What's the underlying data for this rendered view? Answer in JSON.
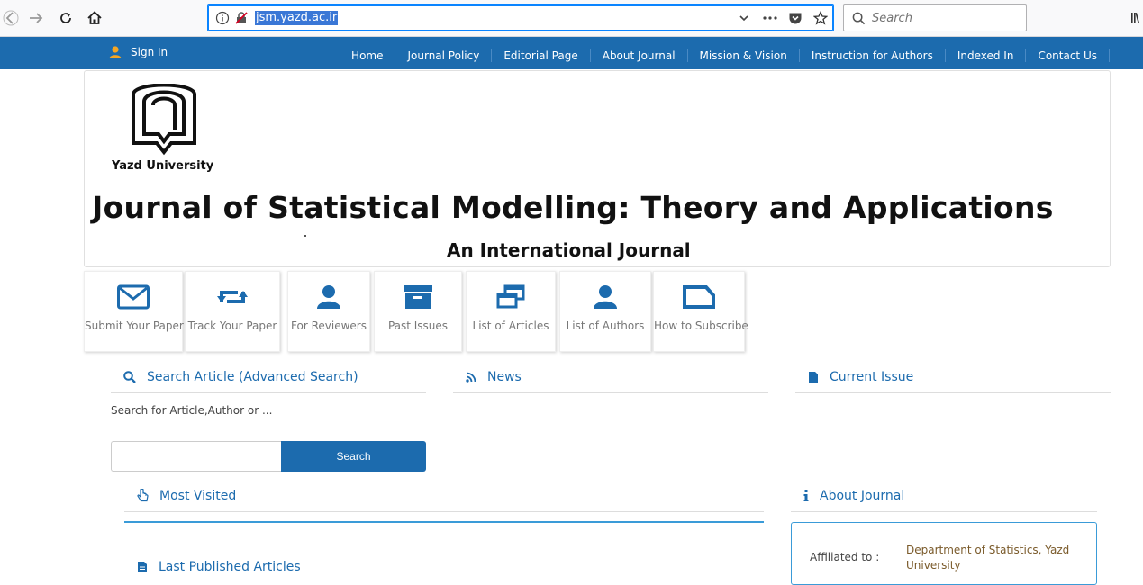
{
  "browser": {
    "url": "jsm.yazd.ac.ir",
    "search_placeholder": "Search"
  },
  "topnav": {
    "signin_label": "Sign In",
    "menu": [
      {
        "label": "Home"
      },
      {
        "label": "Journal Policy"
      },
      {
        "label": "Editorial Page"
      },
      {
        "label": "About Journal"
      },
      {
        "label": "Mission & Vision"
      },
      {
        "label": "Instruction for Authors"
      },
      {
        "label": "Indexed In"
      },
      {
        "label": "Contact Us"
      }
    ]
  },
  "banner": {
    "university": "Yazd University",
    "title": "Journal of Statistical Modelling: Theory and Applications",
    "subtitle": "An International Journal"
  },
  "tiles": [
    {
      "label": "Submit Your Paper",
      "icon": "envelope-icon"
    },
    {
      "label": "Track Your Paper",
      "icon": "retweet-icon"
    },
    {
      "label": "For Reviewers",
      "icon": "user-icon"
    },
    {
      "label": "Past Issues",
      "icon": "archive-icon"
    },
    {
      "label": "List of Articles",
      "icon": "stacked-windows-icon"
    },
    {
      "label": "List of Authors",
      "icon": "user-icon"
    },
    {
      "label": "How to Subscribe",
      "icon": "tag-icon"
    }
  ],
  "search_panel": {
    "heading": "Search Article (Advanced Search)",
    "hint": "Search for Article,Author or ...",
    "input_value": "",
    "button_label": "Search"
  },
  "news_panel": {
    "heading": "News"
  },
  "current_issue_panel": {
    "heading": "Current Issue"
  },
  "most_visited": {
    "heading": "Most Visited"
  },
  "last_published": {
    "heading": "Last Published Articles"
  },
  "about_journal": {
    "heading": "About Journal",
    "affiliated_label": "Affiliated to :",
    "affiliated_value": "Department of Statistics, Yazd University"
  },
  "colors": {
    "brand": "#1c6bae",
    "accent": "#3a9bd8"
  }
}
